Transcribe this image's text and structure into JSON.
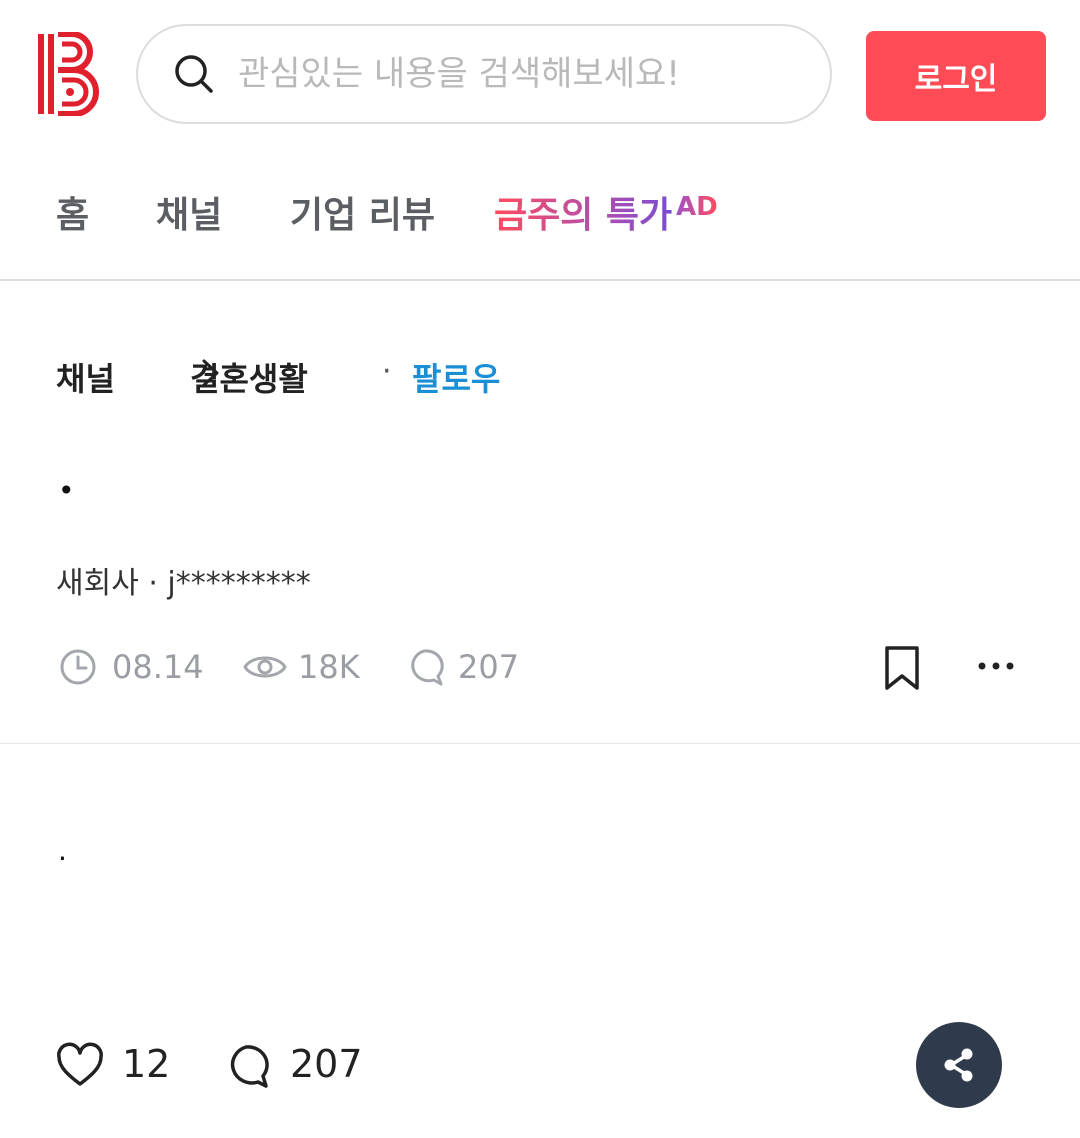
{
  "header": {
    "logo_name": "logo",
    "search_placeholder": "관심있는 내용을 검색해보세요!",
    "login_label": "로그인",
    "brand_color": "#ff4b55"
  },
  "nav": {
    "items": [
      {
        "label": "홈"
      },
      {
        "label": "채널"
      },
      {
        "label": "기업 리뷰"
      },
      {
        "label": "금주의 특가"
      }
    ],
    "ad_badge": "AD"
  },
  "breadcrumb": {
    "root": "채널",
    "channel": "결혼생활",
    "separator": "·",
    "follow_label": "팔로우",
    "follow_color": "#1a8fd6"
  },
  "post": {
    "title": "•",
    "author": "새회사 · j*********",
    "date": "08.14",
    "views": "18K",
    "comments": "207",
    "body": "."
  },
  "actions": {
    "likes": "12",
    "comments": "207"
  },
  "icons": {
    "search": "search-icon",
    "clock": "clock-icon",
    "eye": "eye-icon",
    "comment": "comment-icon",
    "bookmark": "bookmark-icon",
    "more": "more-icon",
    "heart": "heart-icon",
    "share": "share-icon"
  }
}
